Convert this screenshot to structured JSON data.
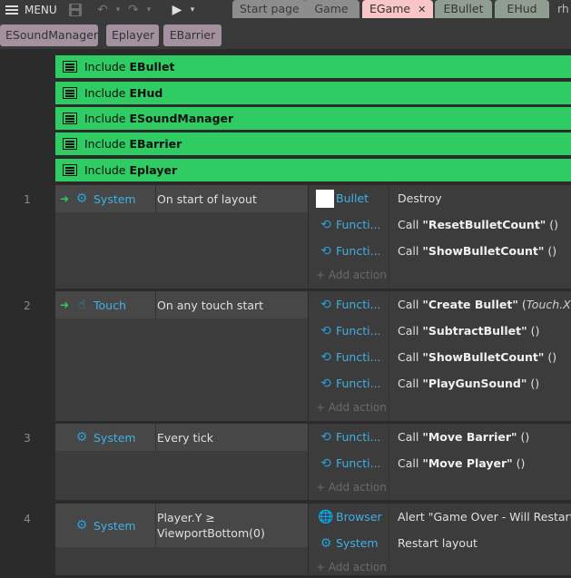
{
  "toolbar": {
    "menu_label": "MENU"
  },
  "tabs": [
    {
      "label": "Start page",
      "style": "gray"
    },
    {
      "label": "Game",
      "style": "gray"
    },
    {
      "label": "EGame",
      "style": "active",
      "close": "✕"
    },
    {
      "label": "EBullet",
      "style": "green"
    },
    {
      "label": "EHud",
      "style": "green"
    },
    {
      "label": "rh",
      "style": "plain"
    }
  ],
  "tabs_row2": [
    {
      "label": "ESoundManager"
    },
    {
      "label": "Eplayer"
    },
    {
      "label": "EBarrier"
    }
  ],
  "includes": [
    {
      "prefix": "Include",
      "name": "EBullet"
    },
    {
      "prefix": "Include",
      "name": "EHud"
    },
    {
      "prefix": "Include",
      "name": "ESoundManager"
    },
    {
      "prefix": "Include",
      "name": "EBarrier"
    },
    {
      "prefix": "Include",
      "name": "Eplayer"
    }
  ],
  "events": [
    {
      "number": "1",
      "object": "System",
      "icon": "gear-icon",
      "condition": "On start of layout",
      "actions": [
        {
          "icon": "white-square-icon",
          "object": "Bullet",
          "desc_plain": "Destroy",
          "desc_bold": "",
          "desc_tail": "",
          "desc_italic": ""
        },
        {
          "icon": "function-icon",
          "object": "Functi...",
          "desc_plain": "Call ",
          "desc_bold": "\"ResetBulletCount\"",
          "desc_tail": " ()",
          "desc_italic": ""
        },
        {
          "icon": "function-icon",
          "object": "Functi...",
          "desc_plain": "Call ",
          "desc_bold": "\"ShowBulletCount\"",
          "desc_tail": " ()",
          "desc_italic": ""
        }
      ],
      "add_action": "+ Add action"
    },
    {
      "number": "2",
      "object": "Touch",
      "icon": "touch-icon",
      "condition": "On any touch start",
      "actions": [
        {
          "icon": "function-icon",
          "object": "Functi...",
          "desc_plain": "Call ",
          "desc_bold": "\"Create Bullet\"",
          "desc_tail": " (",
          "desc_italic": "Touch.X, Tou"
        },
        {
          "icon": "function-icon",
          "object": "Functi...",
          "desc_plain": "Call ",
          "desc_bold": "\"SubtractBullet\"",
          "desc_tail": " ()",
          "desc_italic": ""
        },
        {
          "icon": "function-icon",
          "object": "Functi...",
          "desc_plain": "Call ",
          "desc_bold": "\"ShowBulletCount\"",
          "desc_tail": " ()",
          "desc_italic": ""
        },
        {
          "icon": "function-icon",
          "object": "Functi...",
          "desc_plain": "Call ",
          "desc_bold": "\"PlayGunSound\"",
          "desc_tail": " ()",
          "desc_italic": ""
        }
      ],
      "add_action": "+ Add action"
    },
    {
      "number": "3",
      "object": "System",
      "icon": "gear-icon",
      "condition": "Every tick",
      "actions": [
        {
          "icon": "function-icon",
          "object": "Functi...",
          "desc_plain": "Call ",
          "desc_bold": "\"Move Barrier\"",
          "desc_tail": " ()",
          "desc_italic": ""
        },
        {
          "icon": "function-icon",
          "object": "Functi...",
          "desc_plain": "Call ",
          "desc_bold": "\"Move Player\"",
          "desc_tail": " ()",
          "desc_italic": ""
        }
      ],
      "add_action": "+ Add action"
    },
    {
      "number": "4",
      "object": "System",
      "icon": "gear-icon",
      "condition_line1": "Player.Y ≥",
      "condition_line2": "ViewportBottom(0)",
      "actions": [
        {
          "icon": "globe-icon",
          "object": "Browser",
          "desc_plain": "Alert \"Game Over - Will Restart\"",
          "desc_bold": "",
          "desc_tail": "",
          "desc_italic": ""
        },
        {
          "icon": "gear-icon",
          "object": "System",
          "desc_plain": "Restart layout",
          "desc_bold": "",
          "desc_tail": "",
          "desc_italic": ""
        }
      ],
      "add_action": "+ Add action"
    }
  ]
}
